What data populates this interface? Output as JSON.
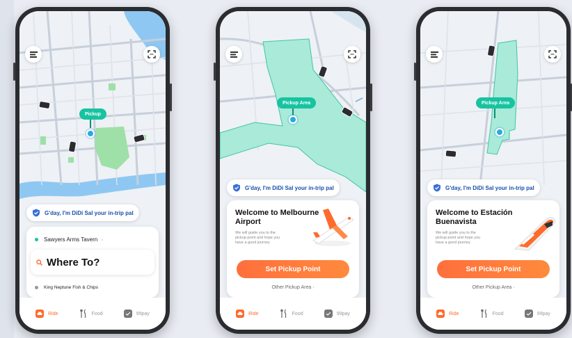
{
  "colors": {
    "accent_orange": "#ff6b2c",
    "pickup_green": "#17c3a1",
    "trust_blue": "#1b4fa8",
    "map_water": "#8ec8f2",
    "map_park": "#9fe0a8",
    "zone_fill": "#a9ead9"
  },
  "phone1": {
    "map_marker_label": "Pickup",
    "assistant_pill": "G'day, I'm DiDi Sal your in-trip pal",
    "recent_place_1": "Sawyers Arms Tavern",
    "recent_place_1_chevron": "›",
    "where_to": "Where To?",
    "recent_place_2": "King Neptune Fish & Chips",
    "tabs": [
      {
        "label": "Ride",
        "icon": "car-icon"
      },
      {
        "label": "Food",
        "icon": "fork-knife-icon"
      },
      {
        "label": "99pay",
        "icon": "wallet-icon"
      }
    ]
  },
  "phone2": {
    "map_marker_label": "Pickup Area",
    "assistant_pill": "G'day, I'm DiDi Sal your in-trip pal",
    "welcome_title": "Welcome to Melbourne Airport",
    "welcome_sub": "We will guide you to the pickup point and hope you have a good journey",
    "cta": "Set Pickup Point",
    "other_link": "Other Pickup Area",
    "other_chevron": "›",
    "tabs": [
      {
        "label": "Ride",
        "icon": "car-icon"
      },
      {
        "label": "Food",
        "icon": "fork-knife-icon"
      },
      {
        "label": "99pay",
        "icon": "wallet-icon"
      }
    ]
  },
  "phone3": {
    "map_marker_label": "Pickup Area",
    "assistant_pill": "G'day, I'm DiDi Sal your in-trip pal",
    "welcome_title": "Welcome to Estación Buenavista",
    "welcome_sub": "We will guide you to the pickup point and hope you have a good journey",
    "cta": "Set Pickup Point",
    "other_link": "Other Pickup Area",
    "other_chevron": "›",
    "tabs": [
      {
        "label": "Ride",
        "icon": "car-icon"
      },
      {
        "label": "Food",
        "icon": "fork-knife-icon"
      },
      {
        "label": "99pay",
        "icon": "wallet-icon"
      }
    ]
  }
}
